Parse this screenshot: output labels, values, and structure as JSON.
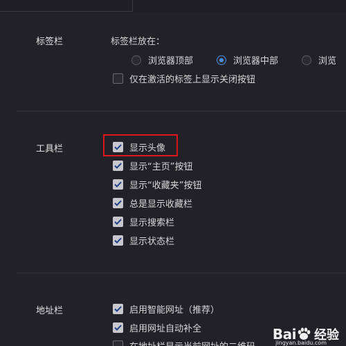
{
  "sections": {
    "tabbar": {
      "label": "标签栏",
      "position_label": "标签栏放在：",
      "radios": [
        {
          "label": "浏览器顶部",
          "checked": false
        },
        {
          "label": "浏览器中部",
          "checked": true
        },
        {
          "label": "浏览",
          "checked": false
        }
      ],
      "checkboxes": [
        {
          "label": "仅在激活的标签上显示关闭按钮",
          "checked": false
        }
      ]
    },
    "toolbar": {
      "label": "工具栏",
      "checkboxes": [
        {
          "label": "显示头像",
          "checked": true
        },
        {
          "label": "显示“主页”按钮",
          "checked": true
        },
        {
          "label": "显示“收藏夹”按钮",
          "checked": true
        },
        {
          "label": "总是显示收藏栏",
          "checked": true
        },
        {
          "label": "显示搜索栏",
          "checked": true
        },
        {
          "label": "显示状态栏",
          "checked": true
        }
      ]
    },
    "addressbar": {
      "label": "地址栏",
      "checkboxes": [
        {
          "label": "启用智能网址（推荐）",
          "checked": true
        },
        {
          "label": "启用网址自动补全",
          "checked": true
        },
        {
          "label": "在地址栏显示当前网址的二维码",
          "checked": false
        }
      ]
    }
  },
  "watermark": {
    "text": "Bai",
    "text2": "经验",
    "sub": "jingyan.baidu.com"
  },
  "colors": {
    "background": "#212127",
    "accent": "#4a8ee8",
    "highlight": "#e0151c"
  },
  "icons": {
    "checkmark": "checkmark-icon",
    "paw": "baidu-paw-icon"
  }
}
